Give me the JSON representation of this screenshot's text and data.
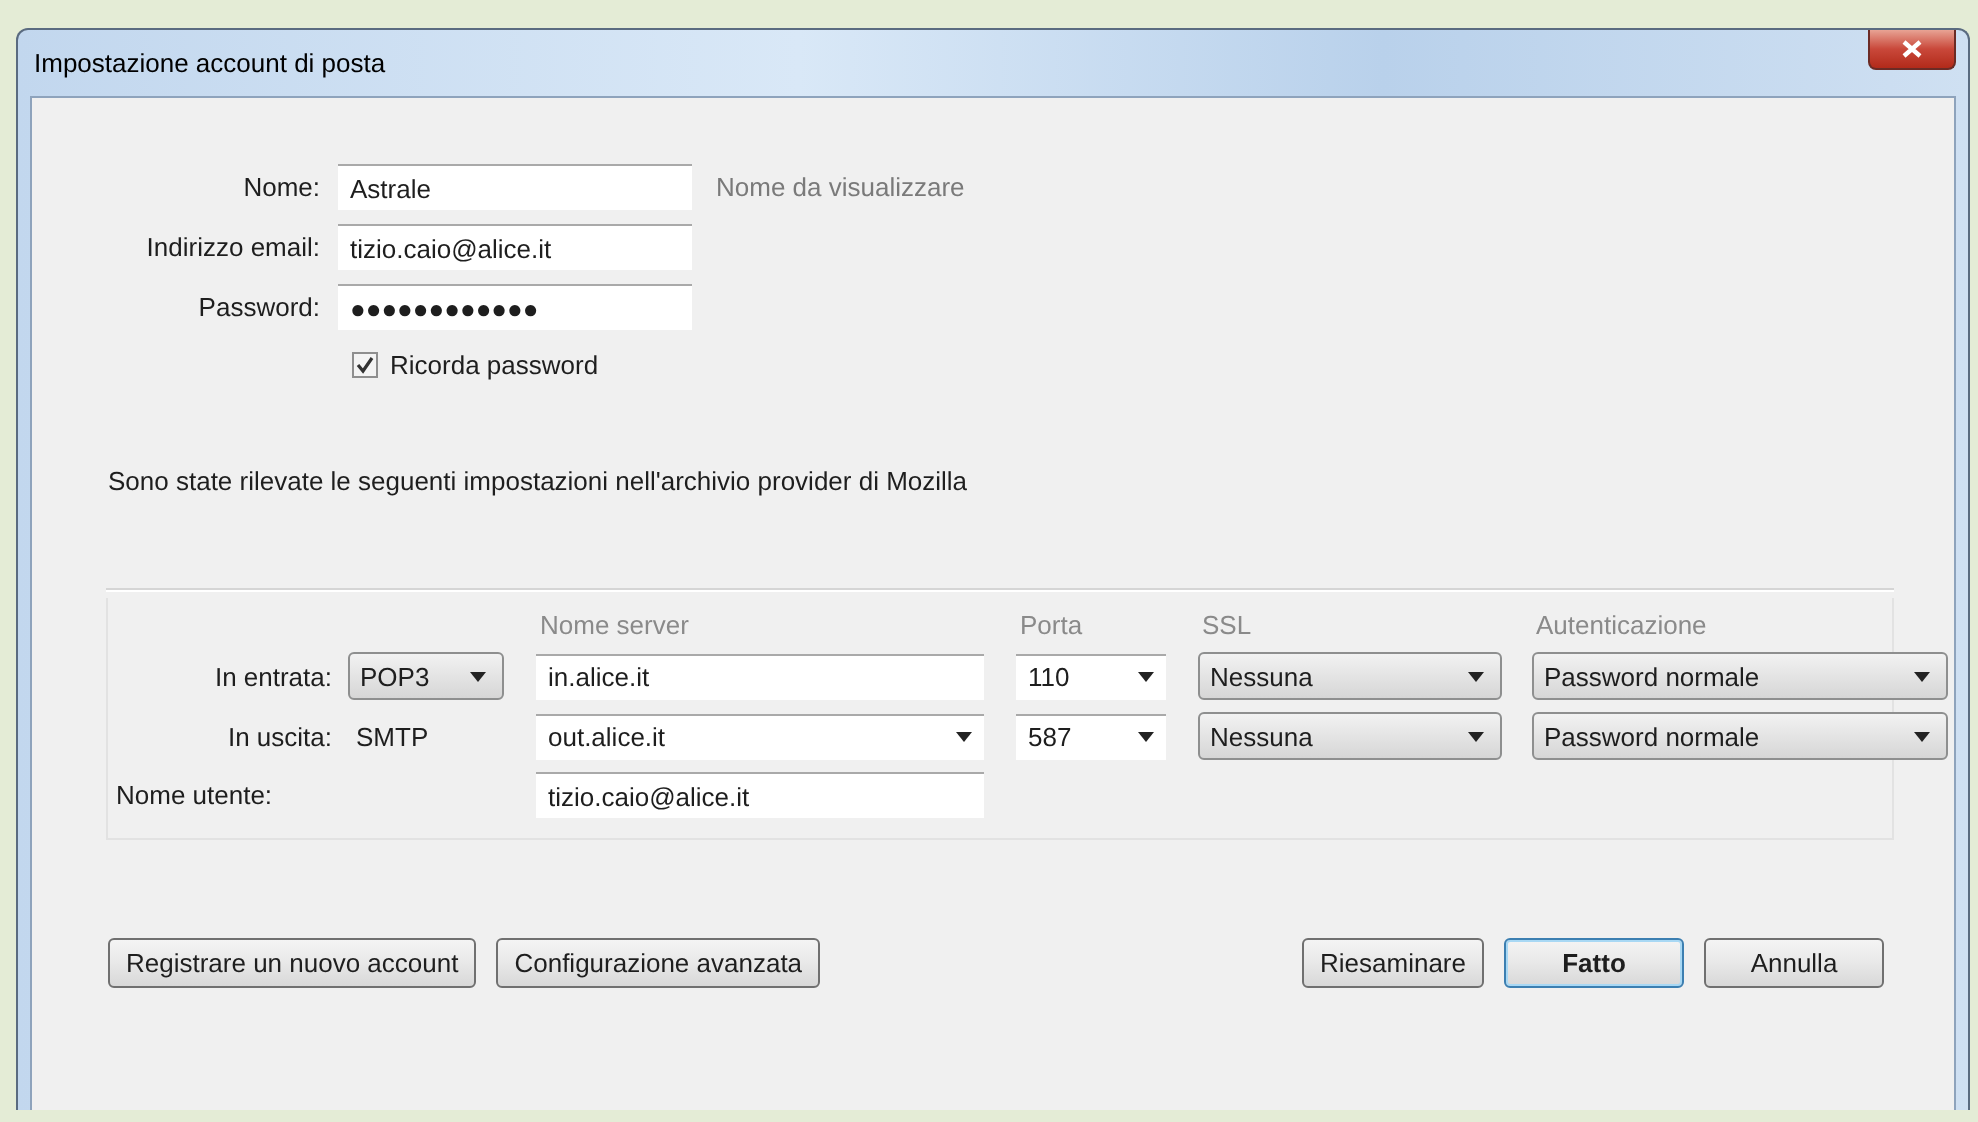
{
  "window": {
    "title": "Impostazione account di posta"
  },
  "account": {
    "fields": [
      {
        "label": "Nome:",
        "value": "Astrale",
        "hint": "Nome da visualizzare"
      },
      {
        "label": "Indirizzo email:",
        "value": "tizio.caio@alice.it"
      },
      {
        "label": "Password:",
        "value": "●●●●●●●●●●●●"
      }
    ],
    "remember": {
      "label": "Ricorda password",
      "checked": true
    }
  },
  "notice": "Sono state rilevate le seguenti impostazioni nell'archivio provider di Mozilla",
  "server": {
    "columns": [
      "Nome server",
      "Porta",
      "SSL",
      "Autenticazione"
    ],
    "rows": [
      {
        "label": "In entrata:",
        "protocol": {
          "value": "POP3",
          "kind": "dropdown"
        },
        "server": {
          "value": "in.alice.it",
          "kind": "text"
        },
        "port": "110",
        "ssl": "Nessuna",
        "auth": "Password normale"
      },
      {
        "label": "In uscita:",
        "protocol": {
          "value": "SMTP",
          "kind": "static"
        },
        "server": {
          "value": "out.alice.it",
          "kind": "combo"
        },
        "port": "587",
        "ssl": "Nessuna",
        "auth": "Password normale"
      }
    ],
    "username": {
      "label": "Nome utente:",
      "value": "tizio.caio@alice.it"
    }
  },
  "buttons_left": [
    {
      "label": "Registrare un nuovo account",
      "default": false
    },
    {
      "label": "Configurazione avanzata",
      "default": false
    }
  ],
  "buttons_right": [
    {
      "label": "Riesaminare",
      "default": false
    },
    {
      "label": "Fatto",
      "default": true
    },
    {
      "label": "Annulla",
      "default": false
    }
  ]
}
